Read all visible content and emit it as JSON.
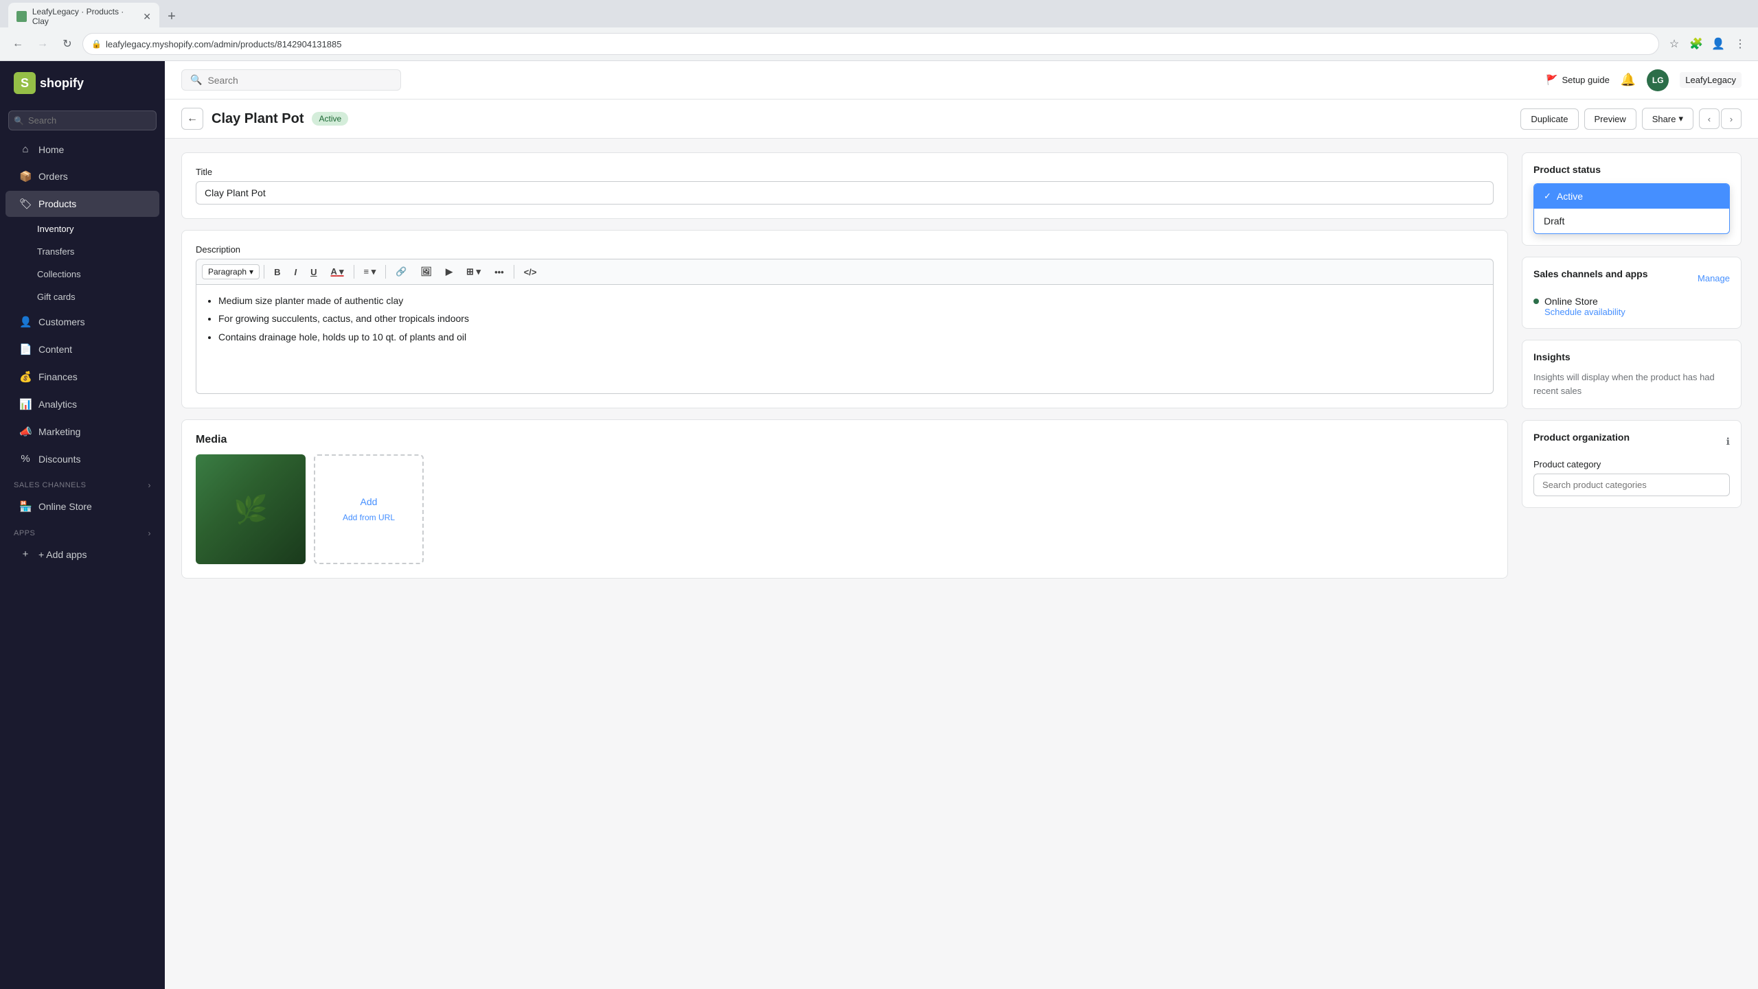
{
  "browser": {
    "tab_label": "LeafyLegacy · Products · Clay",
    "url": "leafylegacy.myshopify.com/admin/products/8142904131885",
    "new_tab_icon": "+",
    "back_disabled": false,
    "forward_disabled": true
  },
  "header": {
    "search_placeholder": "Search",
    "setup_guide_label": "Setup guide",
    "notification_icon": "🔔",
    "user_initials": "LG",
    "store_name": "LeafyLegacy"
  },
  "sidebar": {
    "logo_text": "shopify",
    "nav_items": [
      {
        "id": "home",
        "label": "Home",
        "icon": "⌂"
      },
      {
        "id": "orders",
        "label": "Orders",
        "icon": "📦"
      },
      {
        "id": "products",
        "label": "Products",
        "icon": "🏷",
        "active": true
      },
      {
        "id": "customers",
        "label": "Customers",
        "icon": "👤"
      },
      {
        "id": "content",
        "label": "Content",
        "icon": "📄"
      },
      {
        "id": "finances",
        "label": "Finances",
        "icon": "💰"
      },
      {
        "id": "analytics",
        "label": "Analytics",
        "icon": "📊"
      },
      {
        "id": "marketing",
        "label": "Marketing",
        "icon": "📣"
      },
      {
        "id": "discounts",
        "label": "Discounts",
        "icon": "%"
      }
    ],
    "products_sub": [
      {
        "id": "inventory",
        "label": "Inventory"
      },
      {
        "id": "transfers",
        "label": "Transfers"
      },
      {
        "id": "collections",
        "label": "Collections"
      },
      {
        "id": "gift-cards",
        "label": "Gift cards"
      }
    ],
    "sales_channels_label": "Sales channels",
    "online_store_label": "Online Store",
    "apps_label": "Apps",
    "add_apps_label": "+ Add apps"
  },
  "page": {
    "title": "Clay Plant Pot",
    "status_badge": "Active",
    "back_btn": "←",
    "duplicate_btn": "Duplicate",
    "preview_btn": "Preview",
    "share_btn": "Share",
    "prev_btn": "‹",
    "next_btn": "›"
  },
  "product_form": {
    "title_label": "Title",
    "title_value": "Clay Plant Pot",
    "description_label": "Description",
    "description_format": "Paragraph",
    "description_bullets": [
      "Medium size planter made of authentic clay",
      "For growing succulents, cactus, and other tropicals indoors",
      "Contains drainage hole, holds up to 10 qt. of plants and oil"
    ],
    "media_section": "Media",
    "media_add_label": "Add",
    "media_add_url_label": "Add from URL"
  },
  "status_panel": {
    "title": "Product status",
    "options": [
      {
        "value": "active",
        "label": "Active",
        "selected": true
      },
      {
        "value": "draft",
        "label": "Draft",
        "selected": false
      }
    ]
  },
  "sales_channels_panel": {
    "title": "Sales channels and apps",
    "manage_label": "Manage",
    "online_store_label": "Online Store",
    "schedule_label": "Schedule availability"
  },
  "insights_panel": {
    "title": "Insights",
    "body": "Insights will display when the product has had recent sales"
  },
  "product_org_panel": {
    "title": "Product organization",
    "info_icon": "ℹ",
    "category_label": "Product category",
    "category_placeholder": "Search product categories"
  },
  "toolbar": {
    "bold": "B",
    "italic": "I",
    "underline": "U",
    "text_color": "A",
    "align": "≡",
    "link": "🔗",
    "image": "🖼",
    "media": "▶",
    "table": "⊞",
    "more": "•••",
    "code": "</>",
    "paragraph_label": "Paragraph"
  }
}
